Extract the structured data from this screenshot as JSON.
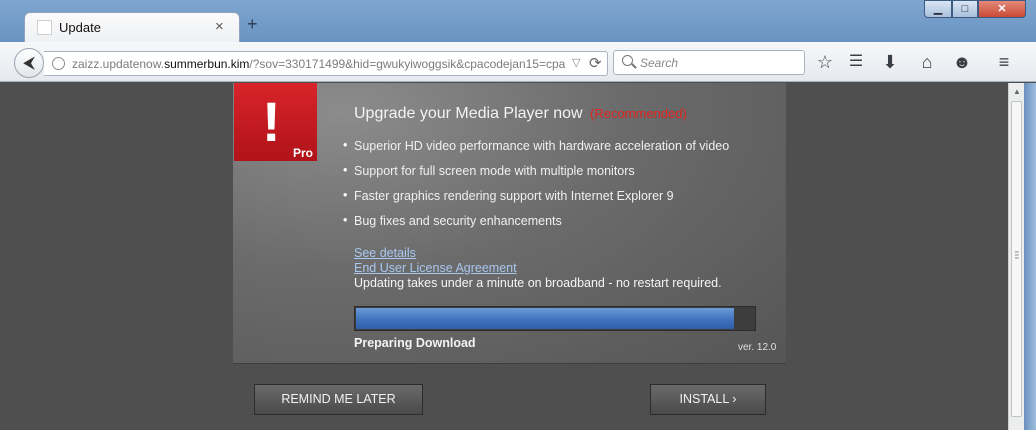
{
  "browser": {
    "tab_title": "Update",
    "new_tab_glyph": "+",
    "tab_close_glyph": "×",
    "window_buttons": {
      "minimize": "▁",
      "maximize": "□",
      "close": "✕"
    },
    "url_prefix": "zaizz.updatenow.",
    "url_host": "summerbun.kim",
    "url_rest": "/?sov=330171499&hid=gwukyiwoggsik&cpacodejan15=cpa",
    "search_placeholder": "Search",
    "icons": [
      "back-arrow-icon",
      "globe-icon",
      "dropdown-icon",
      "reload-icon",
      "search-icon",
      "star-icon",
      "reading-list-icon",
      "download-icon",
      "home-icon",
      "smiley-icon",
      "hamburger-menu-icon"
    ]
  },
  "dialog": {
    "logo_mark": "!",
    "logo_badge": "Pro",
    "headline": "Upgrade your Media Player now",
    "recommended": "(Recommended)",
    "features": [
      "Superior HD video performance with hardware acceleration of video",
      "Support for full screen mode with multiple monitors",
      "Faster graphics rendering support with Internet Explorer 9",
      "Bug fixes and security enhancements"
    ],
    "see_details": "See details",
    "eula": "End User License Agreement",
    "note": "Updating takes under a minute on broadband - no restart required.",
    "progress_fraction": 0.95,
    "progress_label": "Preparing Download",
    "version": "ver. 12.0",
    "remind_label": "REMIND ME LATER",
    "install_label": "INSTALL ›"
  },
  "colors": {
    "accent_red": "#d8242a",
    "recommended_red": "#e0241f",
    "link_blue": "#a9c8ef",
    "progress_blue": "#3f73bd"
  }
}
